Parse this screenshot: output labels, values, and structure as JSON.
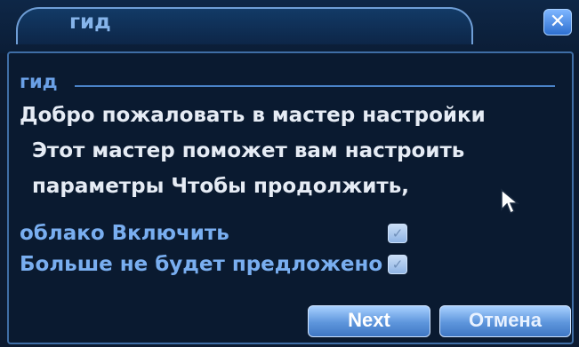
{
  "window": {
    "title": "гид",
    "close_icon": "close-icon"
  },
  "section": {
    "label": "гид"
  },
  "message": {
    "line1": "Добро пожаловать в мастер настройки",
    "line2": "Этот мастер поможет вам настроить",
    "line3": "параметры Чтобы продолжить,"
  },
  "options": {
    "cloud_enable": {
      "label": "облако  Включить",
      "checked": true
    },
    "dont_show_again": {
      "label": "Больше не будет предложено",
      "checked": true
    }
  },
  "buttons": {
    "next": "Next",
    "cancel": "Отмена"
  },
  "colors": {
    "accent": "#6aa0e6",
    "background": "#0a1a30",
    "text": "#e6ecf5"
  }
}
